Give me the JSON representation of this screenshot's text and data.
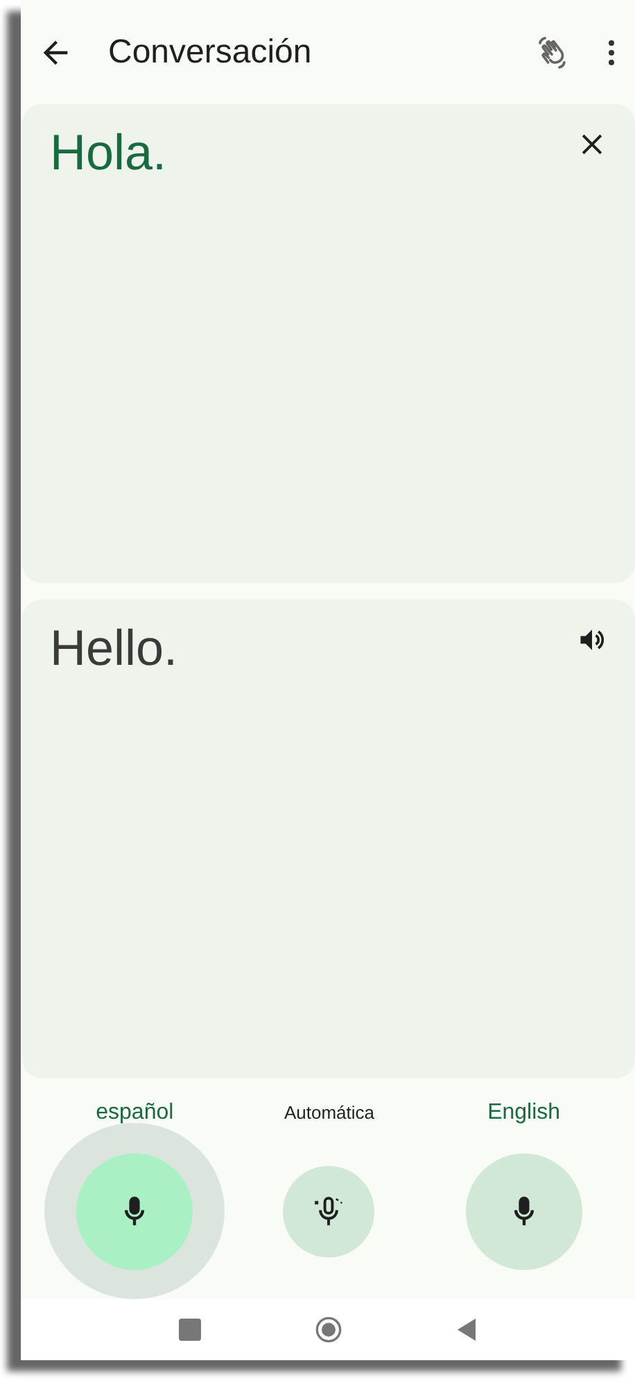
{
  "app_bar": {
    "title": "Conversación"
  },
  "panels": [
    {
      "kind": "source",
      "text": "Hola."
    },
    {
      "kind": "translation",
      "text": "Hello."
    }
  ],
  "speakers": [
    {
      "kind": "language",
      "label": "español",
      "selected": true
    },
    {
      "kind": "auto",
      "label": "Automática",
      "selected": false
    },
    {
      "kind": "language",
      "label": "English",
      "selected": false
    }
  ]
}
